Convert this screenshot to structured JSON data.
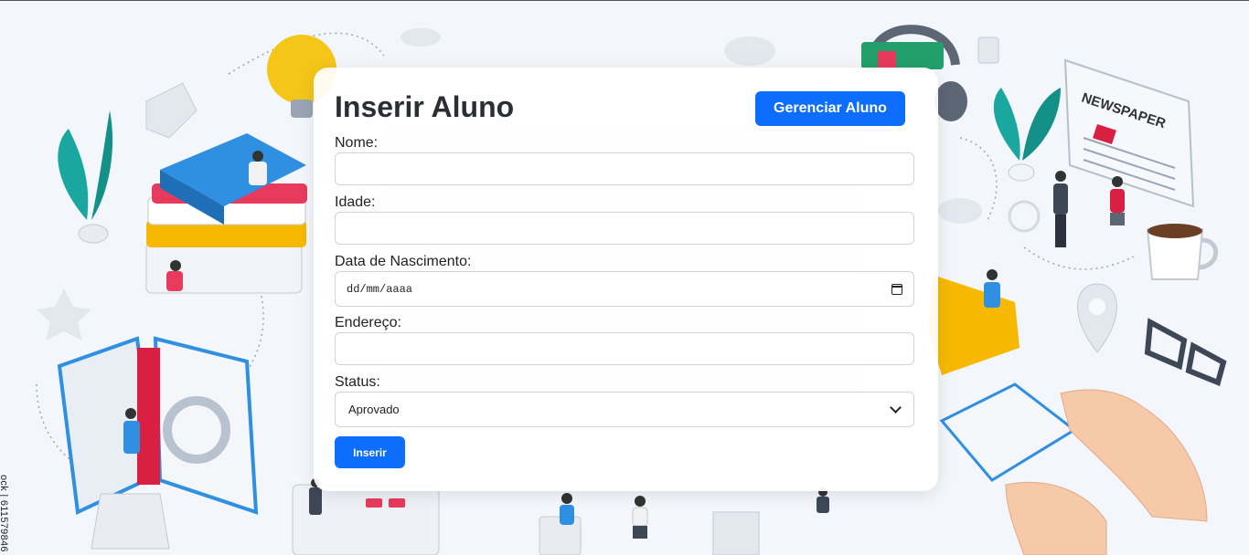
{
  "form": {
    "title": "Inserir Aluno",
    "manage_button": "Gerenciar Aluno",
    "fields": {
      "nome": {
        "label": "Nome:",
        "value": ""
      },
      "idade": {
        "label": "Idade:",
        "value": ""
      },
      "nascimento": {
        "label": "Data de Nascimento:",
        "placeholder": "dd/mm/aaaa"
      },
      "endereco": {
        "label": "Endereço:",
        "value": ""
      },
      "status": {
        "label": "Status:",
        "selected": "Aprovado"
      }
    },
    "submit_button": "Inserir"
  },
  "background": {
    "watermark": "ock | 611579846",
    "newspaper_text": "NEWSPAPER"
  },
  "colors": {
    "accent": "#0d6efd"
  }
}
